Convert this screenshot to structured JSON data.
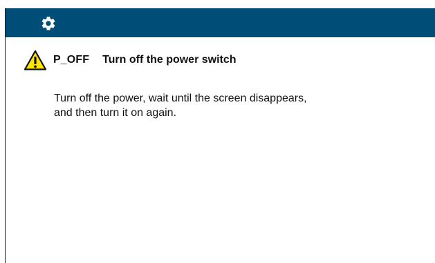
{
  "header": {
    "icon": "gear-icon"
  },
  "alert": {
    "icon": "warning-icon",
    "code": "P_OFF",
    "title": "Turn off the power switch",
    "message_lines": [
      "Turn off the power, wait until the screen disappears,",
      "and then turn it on again."
    ]
  },
  "colors": {
    "header_bg": "#004e78",
    "warning_fill": "#ffe600",
    "text": "#111111"
  }
}
